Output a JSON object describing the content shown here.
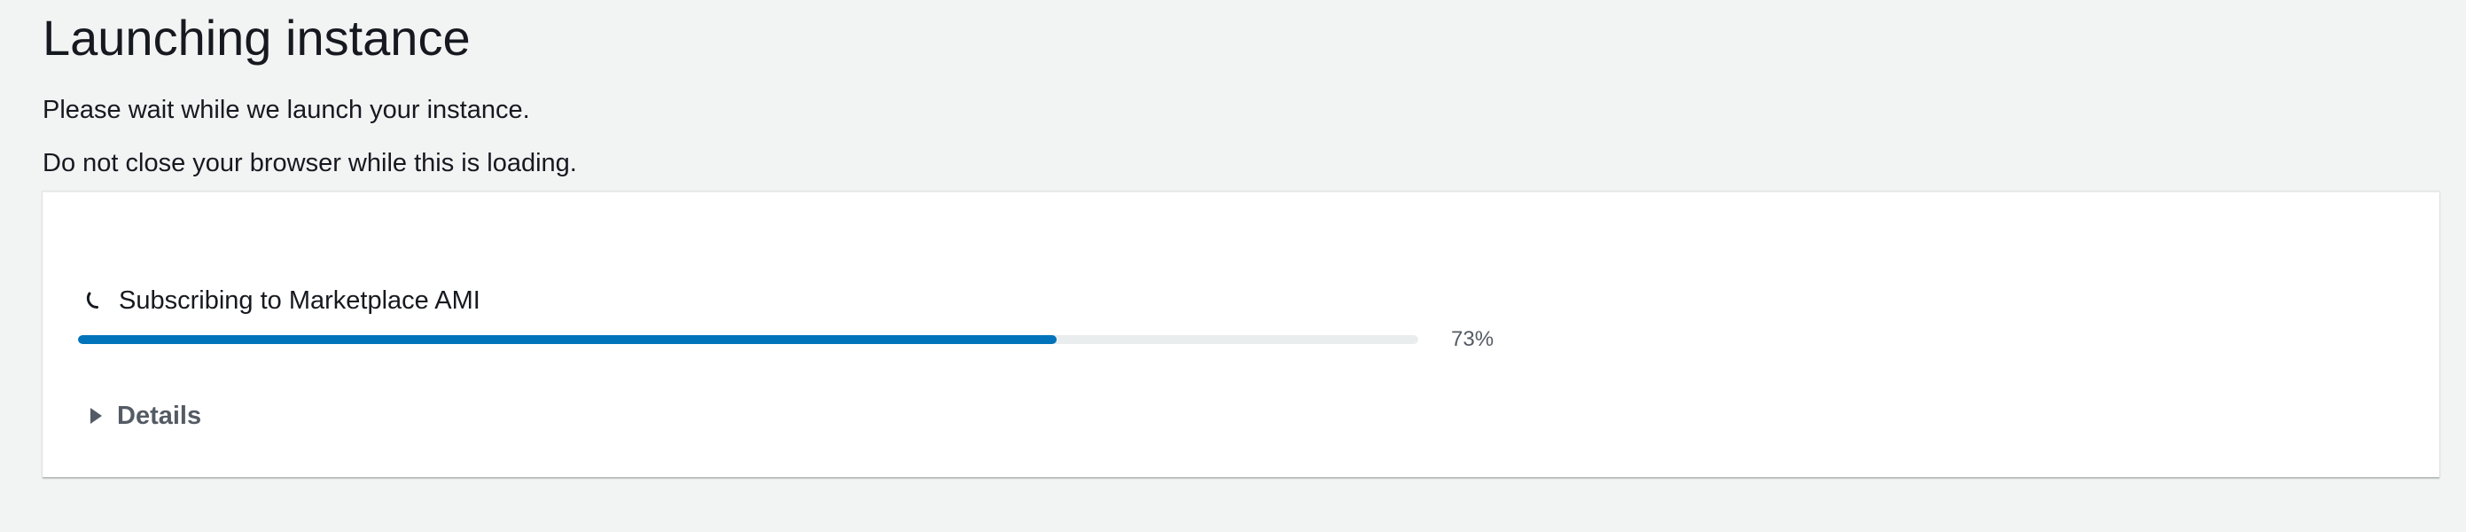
{
  "page": {
    "title": "Launching instance",
    "message_wait": "Please wait while we launch your instance.",
    "message_browser": "Do not close your browser while this is loading."
  },
  "launch_step": {
    "status_icon": "spinner-icon",
    "label": "Subscribing to Marketplace AMI",
    "progress_value": 73,
    "progress_text": "73%"
  },
  "details": {
    "icon": "caret-right-icon",
    "label": "Details",
    "expanded": false
  },
  "colors": {
    "background": "#f2f3f3",
    "card": "#ffffff",
    "progress_fill": "#0073bb",
    "progress_track": "#eaeded",
    "text_primary": "#16191f",
    "text_secondary": "#545b64"
  }
}
